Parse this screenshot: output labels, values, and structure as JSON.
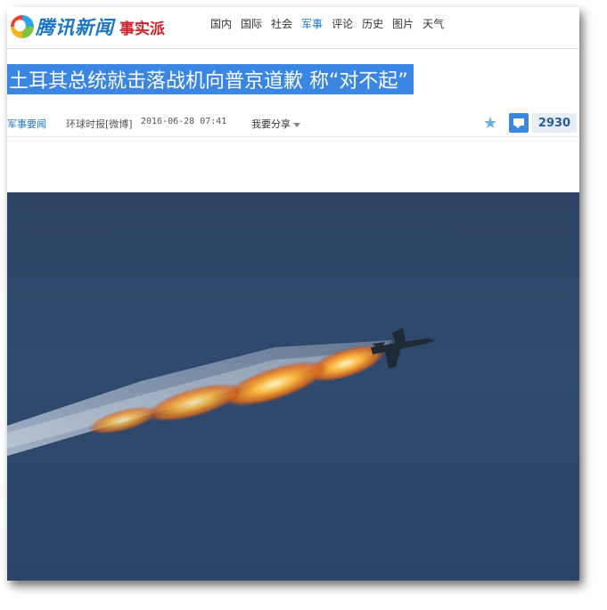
{
  "header": {
    "logo_text": "腾讯新闻",
    "brand_text": "事实派",
    "nav": [
      {
        "label": "国内",
        "active": false
      },
      {
        "label": "国际",
        "active": false
      },
      {
        "label": "社会",
        "active": false
      },
      {
        "label": "军事",
        "active": true
      },
      {
        "label": "评论",
        "active": false
      },
      {
        "label": "历史",
        "active": false
      },
      {
        "label": "图片",
        "active": false
      },
      {
        "label": "天气",
        "active": false
      }
    ]
  },
  "article": {
    "title": "土耳其总统就击落战机向普京道歉 称“对不起”",
    "category": "军事要闻",
    "source": "环球时报[微博]",
    "datetime": "2016-06-28 07:41",
    "share_label": "我要分享",
    "comment_count": "2930"
  },
  "colors": {
    "accent": "#3b86e3",
    "link": "#1a75c6",
    "sky": "#2f4a6e",
    "fire": "#f39a2a"
  },
  "icons": {
    "favorite": "star-icon",
    "comment": "comment-bubble-icon"
  }
}
